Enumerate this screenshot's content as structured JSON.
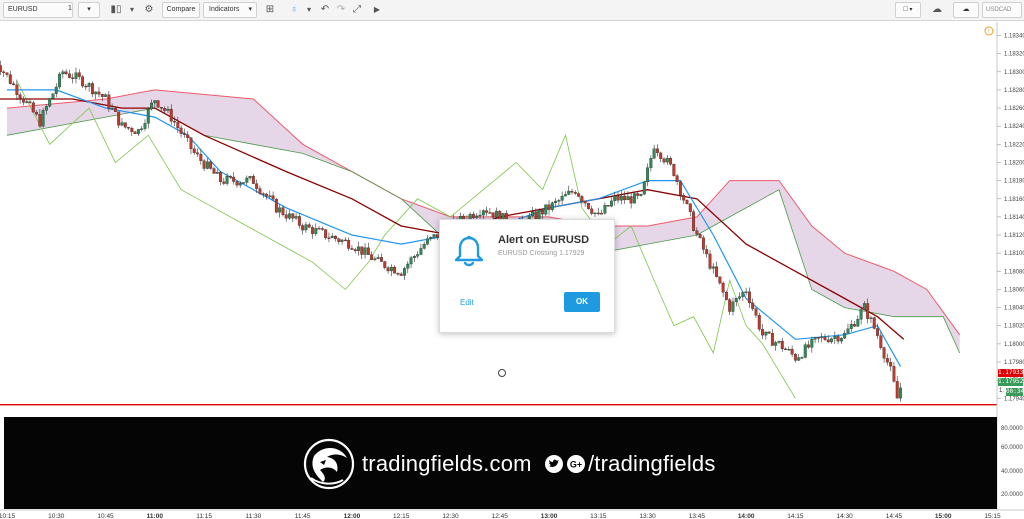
{
  "toolbar": {
    "symbol": "EURUSD",
    "interval": "1",
    "compare_label": "Compare",
    "indicators_label": "Indicators",
    "right_symbol": "USDCAD"
  },
  "alert": {
    "title": "Alert on EURUSD",
    "subtitle": "EURUSD Crossing 1.17929",
    "edit_label": "Edit",
    "ok_label": "OK"
  },
  "branding": {
    "site": "tradingfields.com",
    "handle": "/tradingfields"
  },
  "colors": {
    "up_candle": "#2e8b57",
    "down_candle": "#c0392b",
    "cloud_fill": "#dcc8e0",
    "cloud_red": "#ef5a6a",
    "cloud_green": "#4a9a4a",
    "tenkan": "#2196f3",
    "kijun": "#8b0000",
    "chikou": "#7dc44a",
    "alert_line": "#e00000",
    "accent": "#1e9be0"
  },
  "chart_data": {
    "type": "candlestick",
    "title": "",
    "xlabel": "",
    "ylabel": "",
    "ylim": [
      1.1791,
      1.1835
    ],
    "x_ticks": [
      "10:15",
      "10:30",
      "10:45",
      "11:00",
      "11:15",
      "11:30",
      "11:45",
      "12:00",
      "12:15",
      "12:30",
      "12:45",
      "13:00",
      "13:15",
      "13:30",
      "13:45",
      "14:00",
      "14:15",
      "14:30",
      "14:45",
      "15:00",
      "15:15"
    ],
    "y_ticks": [
      "1.18340",
      "1.18320",
      "1.18300",
      "1.18280",
      "1.18260",
      "1.18240",
      "1.18220",
      "1.18200",
      "1.18180",
      "1.18160",
      "1.18140",
      "1.18120",
      "1.18100",
      "1.18080",
      "1.18060",
      "1.18040",
      "1.18020",
      "1.18000",
      "1.17980",
      "1.17960",
      "1.17940",
      "1.17920"
    ],
    "price_tags": {
      "alert": "1.17933",
      "last": "1.17952",
      "countdown": "00:34"
    },
    "alert_level": 1.17933,
    "close_path": [
      {
        "t": "10:10",
        "p": 1.1832
      },
      {
        "t": "10:18",
        "p": 1.1828
      },
      {
        "t": "10:25",
        "p": 1.18245
      },
      {
        "t": "10:32",
        "p": 1.183
      },
      {
        "t": "10:38",
        "p": 1.1829
      },
      {
        "t": "10:45",
        "p": 1.1827
      },
      {
        "t": "10:50",
        "p": 1.1824
      },
      {
        "t": "10:55",
        "p": 1.18235
      },
      {
        "t": "11:00",
        "p": 1.1827
      },
      {
        "t": "11:05",
        "p": 1.1825
      },
      {
        "t": "11:12",
        "p": 1.1821
      },
      {
        "t": "11:20",
        "p": 1.1818
      },
      {
        "t": "11:30",
        "p": 1.1818
      },
      {
        "t": "11:37",
        "p": 1.1815
      },
      {
        "t": "11:45",
        "p": 1.1813
      },
      {
        "t": "11:52",
        "p": 1.1812
      },
      {
        "t": "12:00",
        "p": 1.1811
      },
      {
        "t": "12:08",
        "p": 1.1809
      },
      {
        "t": "12:15",
        "p": 1.1808
      },
      {
        "t": "12:22",
        "p": 1.1811
      },
      {
        "t": "12:30",
        "p": 1.1813
      },
      {
        "t": "12:40",
        "p": 1.1815
      },
      {
        "t": "12:50",
        "p": 1.1813
      },
      {
        "t": "13:00",
        "p": 1.1815
      },
      {
        "t": "13:08",
        "p": 1.1817
      },
      {
        "t": "13:15",
        "p": 1.1814
      },
      {
        "t": "13:20",
        "p": 1.1816
      },
      {
        "t": "13:28",
        "p": 1.1816
      },
      {
        "t": "13:32",
        "p": 1.1822
      },
      {
        "t": "13:38",
        "p": 1.1819
      },
      {
        "t": "13:45",
        "p": 1.1812
      },
      {
        "t": "13:50",
        "p": 1.1808
      },
      {
        "t": "13:55",
        "p": 1.1804
      },
      {
        "t": "14:00",
        "p": 1.1806
      },
      {
        "t": "14:05",
        "p": 1.1801
      },
      {
        "t": "14:10",
        "p": 1.18
      },
      {
        "t": "14:15",
        "p": 1.17985
      },
      {
        "t": "14:22",
        "p": 1.18005
      },
      {
        "t": "14:30",
        "p": 1.1801
      },
      {
        "t": "14:36",
        "p": 1.1804
      },
      {
        "t": "14:40",
        "p": 1.1801
      },
      {
        "t": "14:44",
        "p": 1.1797
      },
      {
        "t": "14:46",
        "p": 1.1794
      },
      {
        "t": "14:47",
        "p": 1.17952
      }
    ],
    "tenkan": [
      {
        "t": "10:15",
        "p": 1.1828
      },
      {
        "t": "10:30",
        "p": 1.1828
      },
      {
        "t": "10:45",
        "p": 1.1826
      },
      {
        "t": "11:00",
        "p": 1.1825
      },
      {
        "t": "11:10",
        "p": 1.1823
      },
      {
        "t": "11:20",
        "p": 1.1819
      },
      {
        "t": "11:40",
        "p": 1.1815
      },
      {
        "t": "12:00",
        "p": 1.1812
      },
      {
        "t": "12:15",
        "p": 1.1811
      },
      {
        "t": "12:30",
        "p": 1.1812
      },
      {
        "t": "12:45",
        "p": 1.1813
      },
      {
        "t": "13:00",
        "p": 1.1815
      },
      {
        "t": "13:15",
        "p": 1.1816
      },
      {
        "t": "13:30",
        "p": 1.1818
      },
      {
        "t": "13:40",
        "p": 1.1818
      },
      {
        "t": "13:50",
        "p": 1.1812
      },
      {
        "t": "14:00",
        "p": 1.1805
      },
      {
        "t": "14:15",
        "p": 1.18005
      },
      {
        "t": "14:30",
        "p": 1.1801
      },
      {
        "t": "14:40",
        "p": 1.1802
      },
      {
        "t": "14:47",
        "p": 1.17975
      }
    ],
    "kijun": [
      {
        "t": "10:10",
        "p": 1.1827
      },
      {
        "t": "10:35",
        "p": 1.1827
      },
      {
        "t": "10:50",
        "p": 1.1826
      },
      {
        "t": "11:00",
        "p": 1.1826
      },
      {
        "t": "11:15",
        "p": 1.1823
      },
      {
        "t": "11:40",
        "p": 1.1819
      },
      {
        "t": "12:00",
        "p": 1.1816
      },
      {
        "t": "12:15",
        "p": 1.1813
      },
      {
        "t": "12:30",
        "p": 1.1812
      },
      {
        "t": "12:45",
        "p": 1.1814
      },
      {
        "t": "13:15",
        "p": 1.1816
      },
      {
        "t": "13:30",
        "p": 1.1817
      },
      {
        "t": "13:45",
        "p": 1.1816
      },
      {
        "t": "14:00",
        "p": 1.1811
      },
      {
        "t": "14:15",
        "p": 1.1808
      },
      {
        "t": "14:30",
        "p": 1.1805
      },
      {
        "t": "14:40",
        "p": 1.1803
      },
      {
        "t": "14:48",
        "p": 1.18005
      }
    ],
    "chikou": [
      {
        "t": "10:18",
        "p": 1.1829
      },
      {
        "t": "10:28",
        "p": 1.1822
      },
      {
        "t": "10:40",
        "p": 1.1826
      },
      {
        "t": "10:48",
        "p": 1.182
      },
      {
        "t": "10:58",
        "p": 1.1823
      },
      {
        "t": "11:08",
        "p": 1.1817
      },
      {
        "t": "11:18",
        "p": 1.1815
      },
      {
        "t": "11:28",
        "p": 1.1813
      },
      {
        "t": "11:38",
        "p": 1.1811
      },
      {
        "t": "11:48",
        "p": 1.1809
      },
      {
        "t": "11:58",
        "p": 1.1806
      },
      {
        "t": "12:05",
        "p": 1.1809
      },
      {
        "t": "12:10",
        "p": 1.1812
      },
      {
        "t": "12:20",
        "p": 1.1816
      },
      {
        "t": "12:30",
        "p": 1.1814
      },
      {
        "t": "12:40",
        "p": 1.1817
      },
      {
        "t": "12:50",
        "p": 1.182
      },
      {
        "t": "12:58",
        "p": 1.1817
      },
      {
        "t": "13:05",
        "p": 1.1823
      },
      {
        "t": "13:10",
        "p": 1.1815
      },
      {
        "t": "13:18",
        "p": 1.1811
      },
      {
        "t": "13:25",
        "p": 1.1813
      },
      {
        "t": "13:32",
        "p": 1.1807
      },
      {
        "t": "13:38",
        "p": 1.1802
      },
      {
        "t": "13:44",
        "p": 1.1803
      },
      {
        "t": "13:50",
        "p": 1.1799
      },
      {
        "t": "13:55",
        "p": 1.1807
      },
      {
        "t": "14:00",
        "p": 1.1802
      },
      {
        "t": "14:05",
        "p": 1.18
      },
      {
        "t": "14:10",
        "p": 1.1797
      },
      {
        "t": "14:15",
        "p": 1.1794
      }
    ],
    "cloud_red": [
      {
        "t": "10:15",
        "p": 1.1826
      },
      {
        "t": "10:45",
        "p": 1.1827
      },
      {
        "t": "11:00",
        "p": 1.1828
      },
      {
        "t": "11:30",
        "p": 1.1827
      },
      {
        "t": "11:45",
        "p": 1.1822
      },
      {
        "t": "12:00",
        "p": 1.1819
      },
      {
        "t": "12:15",
        "p": 1.1816
      },
      {
        "t": "12:30",
        "p": 1.1814
      },
      {
        "t": "12:45",
        "p": 1.1814
      },
      {
        "t": "13:00",
        "p": 1.1814
      },
      {
        "t": "13:15",
        "p": 1.1813
      },
      {
        "t": "13:30",
        "p": 1.1813
      },
      {
        "t": "13:45",
        "p": 1.1814
      },
      {
        "t": "13:55",
        "p": 1.1818
      },
      {
        "t": "14:10",
        "p": 1.1818
      },
      {
        "t": "14:20",
        "p": 1.1813
      },
      {
        "t": "14:30",
        "p": 1.181
      },
      {
        "t": "14:45",
        "p": 1.1808
      },
      {
        "t": "14:55",
        "p": 1.1806
      },
      {
        "t": "15:05",
        "p": 1.1801
      }
    ],
    "cloud_green": [
      {
        "t": "10:15",
        "p": 1.1823
      },
      {
        "t": "10:45",
        "p": 1.1825
      },
      {
        "t": "11:00",
        "p": 1.1826
      },
      {
        "t": "11:15",
        "p": 1.1823
      },
      {
        "t": "11:30",
        "p": 1.1822
      },
      {
        "t": "11:45",
        "p": 1.1821
      },
      {
        "t": "12:00",
        "p": 1.1819
      },
      {
        "t": "12:15",
        "p": 1.1816
      },
      {
        "t": "12:30",
        "p": 1.1811
      },
      {
        "t": "12:45",
        "p": 1.181
      },
      {
        "t": "13:00",
        "p": 1.1811
      },
      {
        "t": "13:15",
        "p": 1.181
      },
      {
        "t": "13:30",
        "p": 1.1811
      },
      {
        "t": "13:45",
        "p": 1.1812
      },
      {
        "t": "13:55",
        "p": 1.1814
      },
      {
        "t": "14:10",
        "p": 1.1817
      },
      {
        "t": "14:20",
        "p": 1.1806
      },
      {
        "t": "14:30",
        "p": 1.1804
      },
      {
        "t": "14:45",
        "p": 1.1803
      },
      {
        "t": "15:00",
        "p": 1.1803
      },
      {
        "t": "15:05",
        "p": 1.1799
      }
    ],
    "oscillator_ticks": [
      "80.0000",
      "60.0000",
      "40.0000",
      "20.0000"
    ]
  }
}
